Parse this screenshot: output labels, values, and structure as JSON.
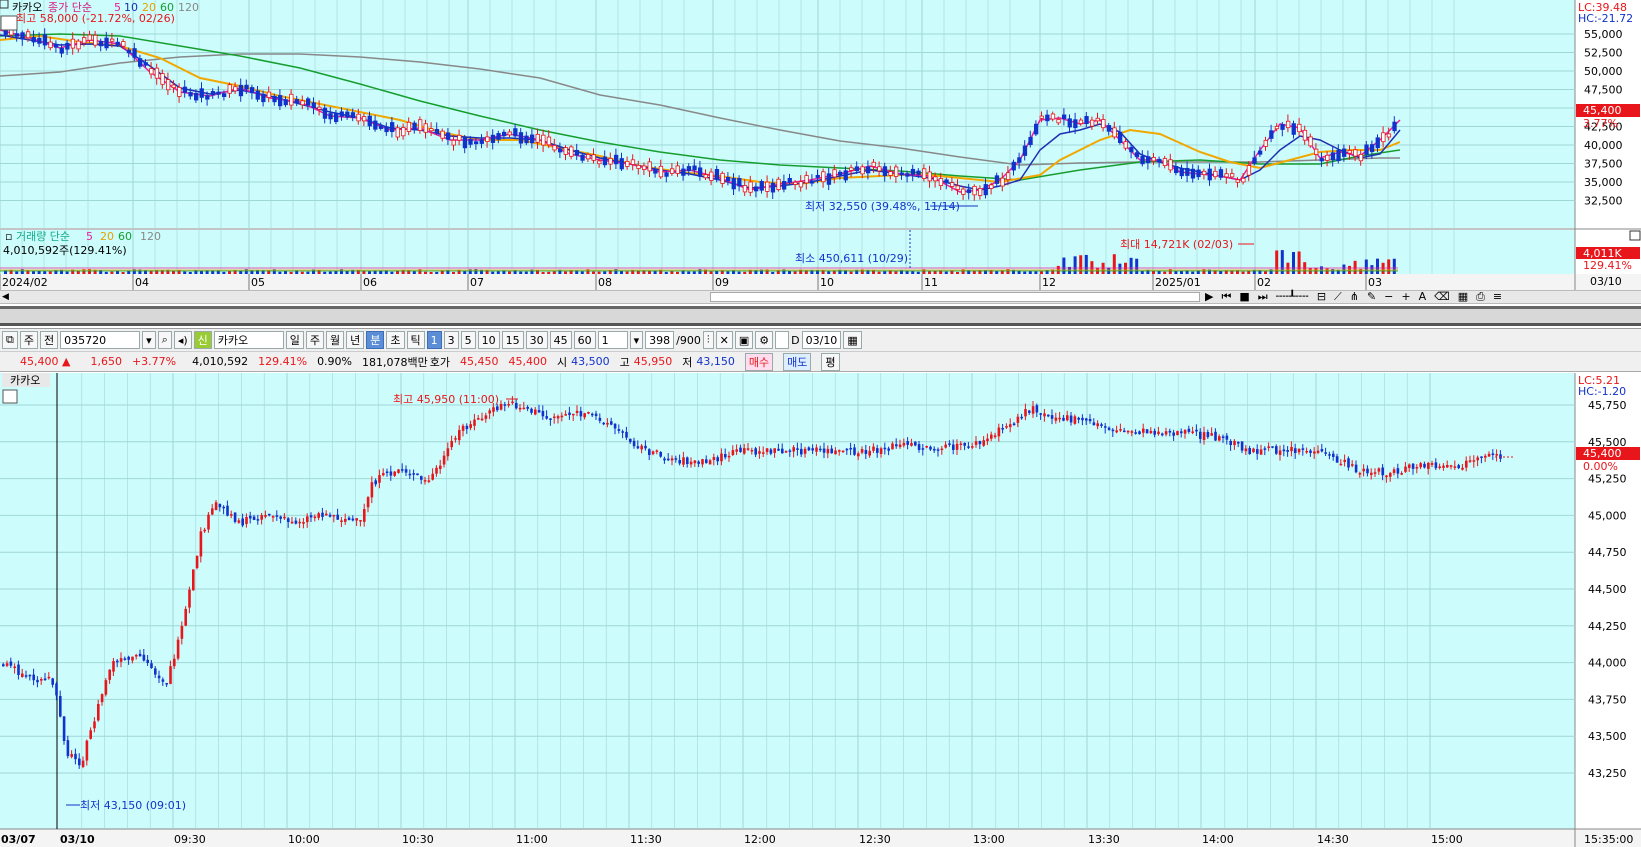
{
  "top_chart": {
    "title": "카카오",
    "legend_price": "종가 단순",
    "ma": [
      "5",
      "10",
      "20",
      "60",
      "120"
    ],
    "ma_colors": [
      "#e8209e",
      "#1e2fb3",
      "#f0a800",
      "#159e2e",
      "#888888"
    ],
    "high_label": "최고 58,000 (-21.72%, 02/26)",
    "low_label": "최저 32,550 (39.48%, 11/14)",
    "lc": "LC:39.48",
    "hc": "HC:-21.72",
    "price_ticks": [
      "55,000",
      "52,500",
      "50,000",
      "47,500",
      "45,000",
      "42,500",
      "40,000",
      "37,500",
      "35,000",
      "32,500"
    ],
    "current_price": "45,400",
    "current_change": "3.77%",
    "volume_title": "거래량 단순",
    "volume_value": "4,010,592주(129.41%)",
    "volume_min_label": "최소 450,611 (10/29)",
    "volume_max_label": "최대 14,721K (02/03)",
    "volume_current": "4,011K",
    "volume_pct": "129.41%",
    "dates": [
      "2024/02",
      "04",
      "05",
      "06",
      "07",
      "08",
      "09",
      "10",
      "11",
      "12",
      "2025/01",
      "02",
      "03"
    ],
    "right_date": "03/10"
  },
  "toolbar": {
    "week_label": "주",
    "prev_label": "전",
    "code": "035720",
    "badge": "신",
    "name": "카카오",
    "periods": [
      "일",
      "주",
      "월",
      "년",
      "분",
      "초",
      "틱"
    ],
    "selected_period": "분",
    "minutes": [
      "1",
      "3",
      "5",
      "10",
      "15",
      "30",
      "45",
      "60"
    ],
    "selected_minute": "1",
    "multiplier": "1",
    "count": "398",
    "count_total": "/900",
    "d_label": "D",
    "date": "03/10"
  },
  "infobar": {
    "price": "45,400 ▲",
    "change": "1,650",
    "rate": "+3.77%",
    "volume": "4,010,592",
    "vol_rate": "129.41%",
    "turnover": "0.90%",
    "amount": "181,078백만",
    "ask_label": "호가",
    "ask1": "45,450",
    "ask2": "45,400",
    "open_label": "시",
    "open": "43,500",
    "high_label": "고",
    "high": "45,950",
    "low_label": "저",
    "low": "43,150",
    "buy_label": "매수",
    "sell_label": "매도",
    "avg_label": "평"
  },
  "bottom_chart": {
    "title": "카카오",
    "high_label": "최고 45,950 (11:00)",
    "low_label": "최저 43,150 (09:01)",
    "lc": "LC:5.21",
    "hc": "HC:-1.20",
    "price_ticks": [
      "45,750",
      "45,500",
      "45,250",
      "45,000",
      "44,750",
      "44,500",
      "44,250",
      "44,000",
      "43,750",
      "43,500",
      "43,250"
    ],
    "current_price": "45,400",
    "current_change": "0.00%",
    "times": [
      "03/07",
      "03/10",
      "09:30",
      "10:00",
      "10:30",
      "11:00",
      "11:30",
      "12:00",
      "12:30",
      "13:00",
      "13:30",
      "14:00",
      "14:30",
      "15:00"
    ],
    "right_time": "15:35:00"
  },
  "colors": {
    "bg": "#cdfcfc",
    "grid": "#9fd7d7",
    "up": "#e8161b",
    "down": "#1133cc",
    "axis_bg": "#ffffff"
  }
}
